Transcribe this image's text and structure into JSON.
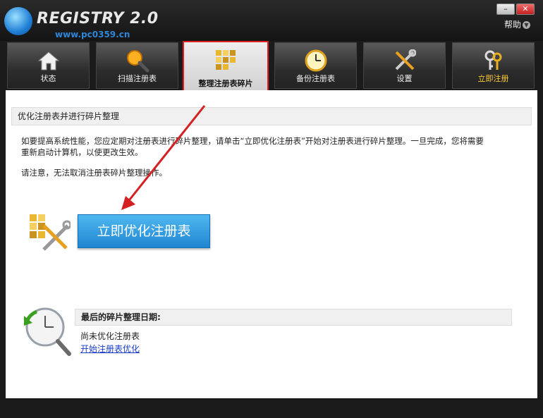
{
  "window": {
    "title": "REGISTRY 2.0",
    "watermark": "www.pc0359.cn",
    "minimize_label": "–",
    "close_label": "✕",
    "help_label": "帮助"
  },
  "tabs": [
    {
      "label": "状态",
      "icon": "home-icon"
    },
    {
      "label": "扫描注册表",
      "icon": "magnifier-icon"
    },
    {
      "label": "整理注册表碎片",
      "icon": "defrag-blocks-icon",
      "active": true
    },
    {
      "label": "备份注册表",
      "icon": "clock-icon"
    },
    {
      "label": "设置",
      "icon": "tools-icon"
    },
    {
      "label": "立即注册",
      "icon": "keys-icon"
    }
  ],
  "main": {
    "section_title": "优化注册表并进行碎片整理",
    "desc_line1": "如要提高系统性能，您应定期对注册表进行碎片整理，请单击“立即优化注册表”开始对注册表进行碎片整理。一旦完成，您将需要",
    "desc_line2": "重新启动计算机，以使更改生效。",
    "note": "请注意，无法取消注册表碎片整理操作。",
    "optimize_button": "立即优化注册表",
    "last_defrag_label": "最后的碎片整理日期:",
    "last_defrag_value": "尚未优化注册表",
    "start_link": "开始注册表优化"
  },
  "colors": {
    "active_tab_border": "#e02020",
    "button_blue": "#2a93d8",
    "link_blue": "#1a3cc8",
    "register_tab_text": "#ffcc33"
  }
}
